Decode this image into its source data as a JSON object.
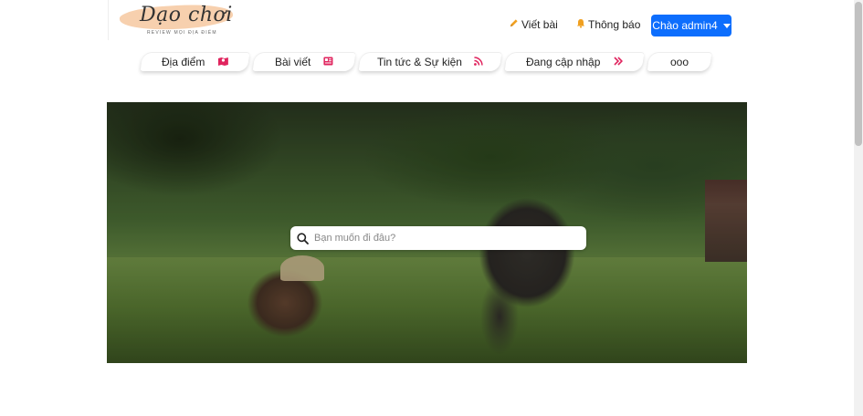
{
  "logo": {
    "title": "Dạo chơi",
    "subtitle": "REVIEW MỌI ĐỊA ĐIỂM"
  },
  "header": {
    "write_label": "Viết bài",
    "notify_label": "Thông báo",
    "greeting_label": "Chào admin4",
    "icons": {
      "write": "pencil-icon",
      "notify": "bell-icon"
    }
  },
  "tabs": [
    {
      "label": "Địa điểm",
      "icon": "map-icon",
      "color": "#e0245e"
    },
    {
      "label": "Bài viết",
      "icon": "newspaper-icon",
      "color": "#e0245e"
    },
    {
      "label": "Tin tức & Sự kiện",
      "icon": "rss-icon",
      "color": "#e0245e"
    },
    {
      "label": "Đang cập nhập",
      "icon": "double-chevron-right-icon",
      "color": "#e0245e"
    },
    {
      "label": "ooo",
      "icon": "",
      "color": ""
    }
  ],
  "search": {
    "placeholder": "Bạn muốn đi đâu?"
  },
  "colors": {
    "primary": "#0d6efd",
    "accent": "#e0245e",
    "logo_swash": "#f7cdaa"
  }
}
